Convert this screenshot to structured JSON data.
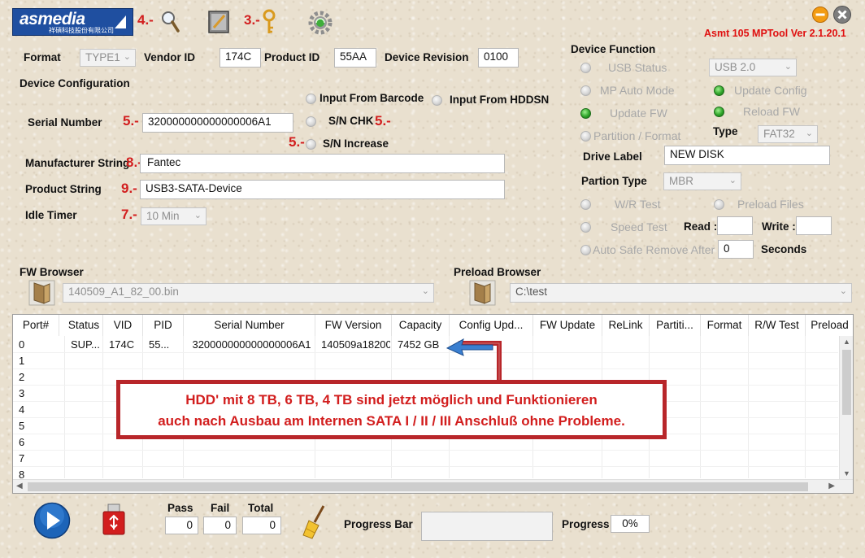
{
  "app": {
    "logo_text": "asmedia",
    "logo_sub": "祥碩科技股份有限公司",
    "version": "Asmt 105 MPTool Ver 2.1.20.1"
  },
  "annotations": {
    "n4": "4.-",
    "n3": "3.-",
    "n5a": "5.-",
    "n5b": "5.-",
    "n5c": "5.-",
    "n8": "8.-",
    "n9": "9.-",
    "n7": "7.-"
  },
  "header": {
    "format_label": "Format",
    "format_value": "TYPE1",
    "vendor_label": "Vendor ID",
    "vendor_value": "174C",
    "product_label": "Product ID",
    "product_value": "55AA",
    "revision_label": "Device Revision",
    "revision_value": "0100"
  },
  "config": {
    "title": "Device Configuration",
    "serial_label": "Serial Number",
    "serial_value": "320000000000000006A1",
    "input_barcode": "Input From Barcode",
    "input_hddsn": "Input From HDDSN",
    "sn_chk": "S/N CHK",
    "sn_increase": "S/N Increase",
    "manufacturer_label": "Manufacturer String",
    "manufacturer_value": "Fantec",
    "product_label": "Product String",
    "product_value": "USB3-SATA-Device",
    "idle_label": "Idle Timer",
    "idle_value": "10 Min"
  },
  "device_function": {
    "title": "Device Function",
    "usb_status": "USB Status",
    "usb_value": "USB 2.0",
    "mp_auto": "MP Auto Mode",
    "update_config": "Update Config",
    "update_fw": "Update FW",
    "reload_fw": "Reload FW",
    "partition_format": "Partition / Format",
    "type_label": "Type",
    "type_value": "FAT32",
    "drive_label": "Drive Label",
    "drive_value": "NEW DISK",
    "partion_type_label": "Partion Type",
    "partion_type_value": "MBR",
    "wr_test": "W/R Test",
    "preload_files": "Preload Files",
    "speed_test": "Speed Test",
    "read_label": "Read :",
    "read_value": "",
    "write_label": "Write :",
    "write_value": "",
    "auto_safe_remove": "Auto Safe Remove After",
    "auto_value": "0",
    "seconds_label": "Seconds"
  },
  "browsers": {
    "fw_label": "FW Browser",
    "fw_value": "140509_A1_82_00.bin",
    "preload_label": "Preload Browser",
    "preload_value": "C:\\test"
  },
  "table": {
    "columns": [
      "Port#",
      "Status",
      "VID",
      "PID",
      "Serial Number",
      "FW Version",
      "Capacity",
      "Config Upd...",
      "FW Update",
      "ReLink",
      "Partiti...",
      "Format",
      "R/W Test",
      "Preload"
    ],
    "rows": [
      [
        "0",
        "SUP...",
        "174C",
        "55...",
        "320000000000000006A1",
        "140509a18200",
        "7452 GB",
        "",
        "",
        "",
        "",
        "",
        "",
        ""
      ],
      [
        "1"
      ],
      [
        "2"
      ],
      [
        "3"
      ],
      [
        "4"
      ],
      [
        "5"
      ],
      [
        "6"
      ],
      [
        "7"
      ],
      [
        "8"
      ]
    ]
  },
  "callout": {
    "line1": "HDD' mit 8 TB, 6 TB, 4 TB sind jetzt möglich und Funktionieren",
    "line2": "auch nach Ausbau am Internen SATA I / II / III Anschluß ohne Probleme."
  },
  "bottom": {
    "pass_label": "Pass",
    "pass_value": "0",
    "fail_label": "Fail",
    "fail_value": "0",
    "total_label": "Total",
    "total_value": "0",
    "progress_bar_label": "Progress Bar",
    "progress_label": "Progress",
    "progress_value": "0%"
  },
  "colors": {
    "annotation_red": "#d21e1e",
    "callout_border": "#b8262a",
    "version_red": "#e01010",
    "logo_blue": "#1f4fa0"
  }
}
